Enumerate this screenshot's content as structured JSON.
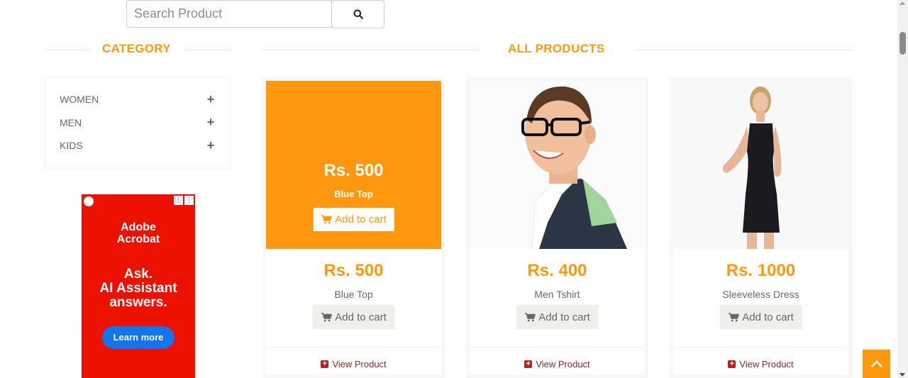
{
  "search": {
    "placeholder": "Search Product",
    "icon": "search-icon"
  },
  "category": {
    "title": "CATEGORY",
    "items": [
      {
        "label": "WOMEN",
        "icon": "plus-icon"
      },
      {
        "label": "MEN",
        "icon": "plus-icon"
      },
      {
        "label": "KIDS",
        "icon": "plus-icon"
      }
    ]
  },
  "ad": {
    "brand_line1": "Adobe",
    "brand_line2": "Acrobat",
    "headline_line1": "Ask.",
    "headline_line2": "AI Assistant",
    "headline_line3": "answers.",
    "cta": "Learn more",
    "colors": {
      "background": "#eb1000",
      "button": "#1473e6"
    }
  },
  "products": {
    "title": "ALL PRODUCTS",
    "items": [
      {
        "price": "Rs. 500",
        "name": "Blue Top",
        "add_label": "Add to cart",
        "view_label": "View Product",
        "hovered": true
      },
      {
        "price": "Rs. 400",
        "name": "Men Tshirt",
        "add_label": "Add to cart",
        "view_label": "View Product"
      },
      {
        "price": "Rs. 1000",
        "name": "Sleeveless Dress",
        "add_label": "Add to cart",
        "view_label": "View Product"
      }
    ]
  },
  "colors": {
    "accent": "#fe980f",
    "text": "#696763",
    "view_link": "#8b2b2b"
  }
}
